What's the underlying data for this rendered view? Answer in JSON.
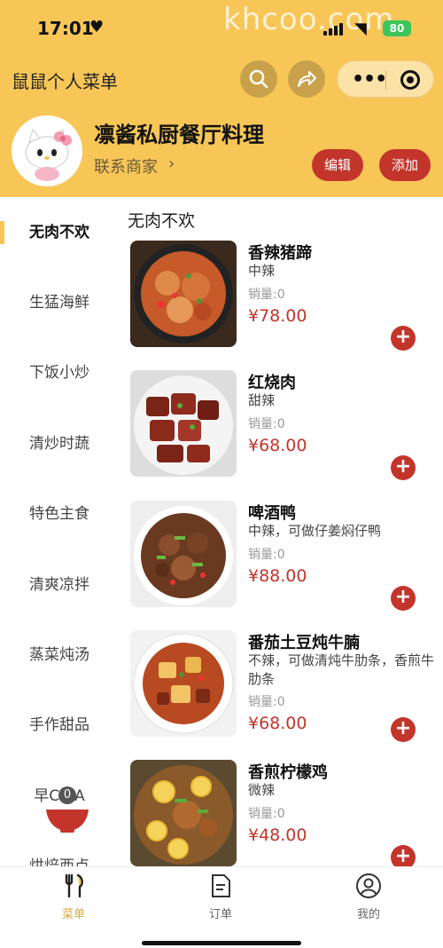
{
  "status_bar": {
    "time": "17:01",
    "watermark": "khcoo.com",
    "battery": "80"
  },
  "nav": {
    "app_title": "鼠鼠个人菜单"
  },
  "shop": {
    "name": "凛酱私厨餐厅料理",
    "contact_label": "联系商家",
    "edit_label": "编辑",
    "add_label": "添加"
  },
  "categories": [
    "无肉不欢",
    "生猛海鲜",
    "下饭小炒",
    "清炒时蔬",
    "特色主食",
    "清爽凉拌",
    "蒸菜炖汤",
    "手作甜品",
    "早C午A",
    "烘焙西点"
  ],
  "section_title": "无肉不欢",
  "dishes": [
    {
      "name": "香辣猪蹄",
      "spice": "中辣",
      "sales": "销量:0",
      "price": "¥78.00"
    },
    {
      "name": "红烧肉",
      "spice": "甜辣",
      "sales": "销量:0",
      "price": "¥68.00"
    },
    {
      "name": "啤酒鸭",
      "spice": "中辣，可做仔姜焖仔鸭",
      "sales": "销量:0",
      "price": "¥88.00"
    },
    {
      "name": "番茄土豆炖牛腩",
      "spice": "不辣，可做清炖牛肋条，香煎牛肋条",
      "sales": "销量:0",
      "price": "¥68.00"
    },
    {
      "name": "香煎柠檬鸡",
      "spice": "微辣",
      "sales": "销量:0",
      "price": "¥48.00"
    }
  ],
  "cart": {
    "count": "0"
  },
  "tabs": [
    {
      "label": "菜单",
      "icon": "fork-knife-icon"
    },
    {
      "label": "订单",
      "icon": "document-icon"
    },
    {
      "label": "我的",
      "icon": "user-icon"
    }
  ],
  "colors": {
    "brand_yellow": "#F7C657",
    "accent_red": "#C3352B"
  }
}
